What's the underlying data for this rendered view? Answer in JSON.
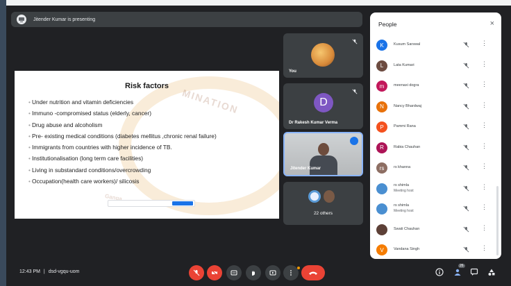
{
  "banner": {
    "text": "Jitender Kumar is presenting"
  },
  "slide": {
    "title": "Risk factors",
    "items": [
      "Under nutrition and vitamin deficiencies",
      "Immuno -compromised status (elderly, cancer)",
      "Drug abuse and alcoholism",
      "Pre- existing medical conditions (diabetes mellitus ,chronic renal failure)",
      "Immigrants from countries with higher incidence of TB.",
      "Institutionalisation (long term care facilities)",
      "Living in substandard conditions/overcrowding",
      "Occupation(health care workers)/ silicosis"
    ]
  },
  "tiles": {
    "you": "You",
    "rakesh": {
      "initial": "D",
      "name": "Dr Rakesh Kumar Verma"
    },
    "jitender": "Jitender Kumar",
    "others": "22 others"
  },
  "people": {
    "title": "People",
    "close": "×",
    "list": [
      {
        "initial": "K",
        "name": "Kusum Sarswal",
        "color": "#1a73e8"
      },
      {
        "initial": "L",
        "name": "Lata Kumari",
        "color": "#6d4c41"
      },
      {
        "initial": "m",
        "name": "meenaxi dogra",
        "color": "#c2185b"
      },
      {
        "initial": "N",
        "name": "Nancy Bhardwaj",
        "color": "#e8710a"
      },
      {
        "initial": "P",
        "name": "Pammi Rana",
        "color": "#f4511e"
      },
      {
        "initial": "R",
        "name": "Rabia Chauhan",
        "color": "#ad1457"
      },
      {
        "initial": "rs",
        "name": "rs khanna",
        "color": "#8d6e63"
      },
      {
        "initial": "",
        "name": "rs shimla",
        "sub": "Meeting host",
        "color": "#4a8fd1"
      },
      {
        "initial": "",
        "name": "rs shimla",
        "sub": "Meeting host",
        "color": "#4a8fd1"
      },
      {
        "initial": "",
        "name": "Swati Chauhan",
        "color": "#5d4037"
      },
      {
        "initial": "V",
        "name": "Vandana Singh",
        "color": "#f57c00"
      }
    ]
  },
  "bottom": {
    "time": "12:43 PM",
    "separator": "|",
    "code": "dsd-vgqu-uom",
    "people_count": "26"
  }
}
